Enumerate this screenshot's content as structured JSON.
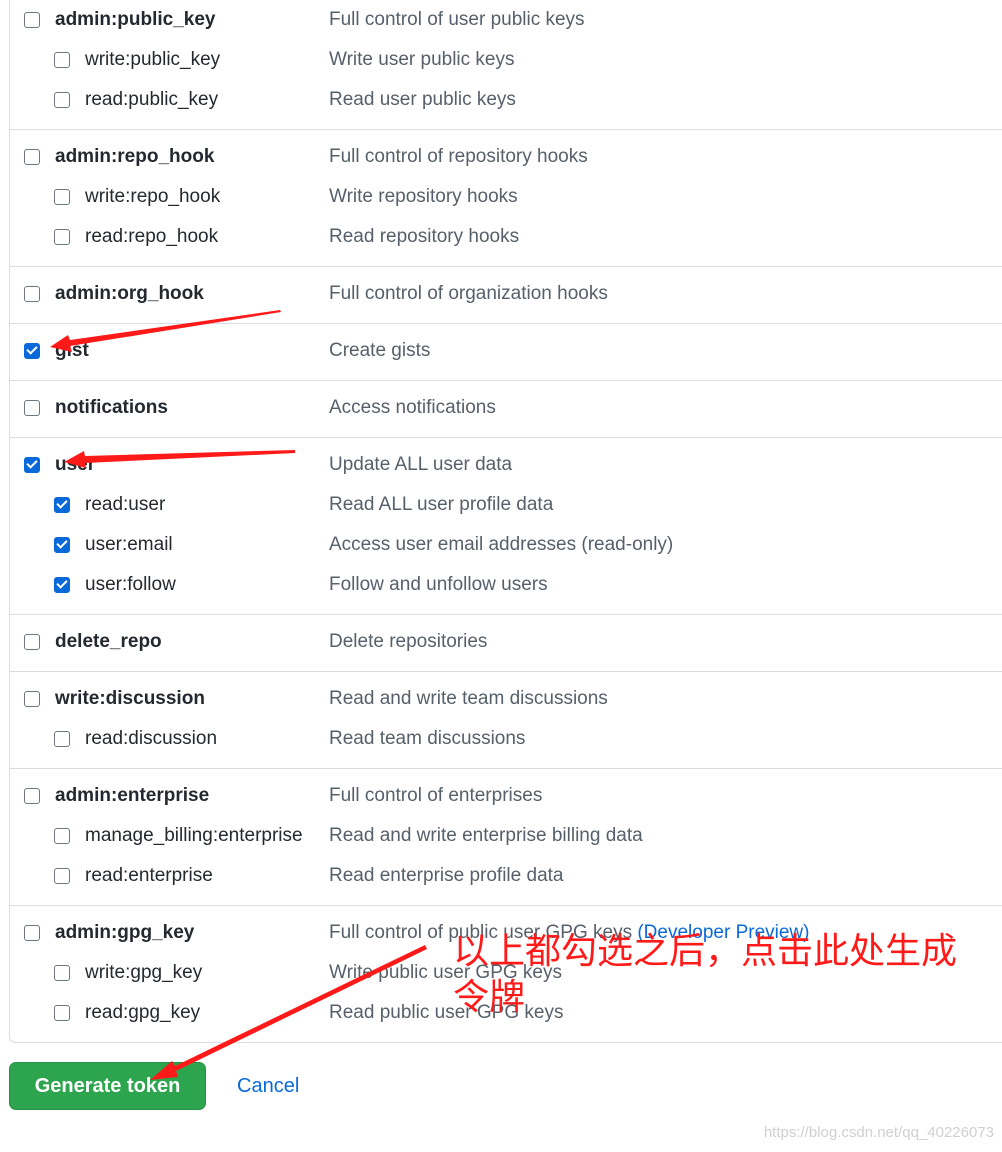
{
  "scopes": [
    {
      "parent": {
        "name": "admin:public_key",
        "desc": "Full control of user public keys",
        "checked": false
      },
      "children": [
        {
          "name": "write:public_key",
          "desc": "Write user public keys",
          "checked": false
        },
        {
          "name": "read:public_key",
          "desc": "Read user public keys",
          "checked": false
        }
      ]
    },
    {
      "parent": {
        "name": "admin:repo_hook",
        "desc": "Full control of repository hooks",
        "checked": false
      },
      "children": [
        {
          "name": "write:repo_hook",
          "desc": "Write repository hooks",
          "checked": false
        },
        {
          "name": "read:repo_hook",
          "desc": "Read repository hooks",
          "checked": false
        }
      ]
    },
    {
      "parent": {
        "name": "admin:org_hook",
        "desc": "Full control of organization hooks",
        "checked": false
      },
      "children": []
    },
    {
      "parent": {
        "name": "gist",
        "desc": "Create gists",
        "checked": true
      },
      "children": []
    },
    {
      "parent": {
        "name": "notifications",
        "desc": "Access notifications",
        "checked": false
      },
      "children": []
    },
    {
      "parent": {
        "name": "user",
        "desc": "Update ALL user data",
        "checked": true
      },
      "children": [
        {
          "name": "read:user",
          "desc": "Read ALL user profile data",
          "checked": true
        },
        {
          "name": "user:email",
          "desc": "Access user email addresses (read-only)",
          "checked": true
        },
        {
          "name": "user:follow",
          "desc": "Follow and unfollow users",
          "checked": true
        }
      ]
    },
    {
      "parent": {
        "name": "delete_repo",
        "desc": "Delete repositories",
        "checked": false
      },
      "children": []
    },
    {
      "parent": {
        "name": "write:discussion",
        "desc": "Read and write team discussions",
        "checked": false
      },
      "children": [
        {
          "name": "read:discussion",
          "desc": "Read team discussions",
          "checked": false
        }
      ]
    },
    {
      "parent": {
        "name": "admin:enterprise",
        "desc": "Full control of enterprises",
        "checked": false
      },
      "children": [
        {
          "name": "manage_billing:enterprise",
          "desc": "Read and write enterprise billing data",
          "checked": false
        },
        {
          "name": "read:enterprise",
          "desc": "Read enterprise profile data",
          "checked": false
        }
      ]
    },
    {
      "parent": {
        "name": "admin:gpg_key",
        "desc": "Full control of public user GPG keys",
        "desc_link": "(Developer Preview)",
        "checked": false
      },
      "children": [
        {
          "name": "write:gpg_key",
          "desc": "Write public user GPG keys",
          "checked": false
        },
        {
          "name": "read:gpg_key",
          "desc": "Read public user GPG keys",
          "checked": false
        }
      ]
    }
  ],
  "actions": {
    "generate": "Generate token",
    "cancel": "Cancel"
  },
  "annotation": "以上都勾选之后，点击此处生成令牌",
  "watermark": "https://blog.csdn.net/qq_40226073",
  "colors": {
    "accent": "#0969da",
    "button": "#2da44e",
    "annotation": "#ff1a1a"
  }
}
